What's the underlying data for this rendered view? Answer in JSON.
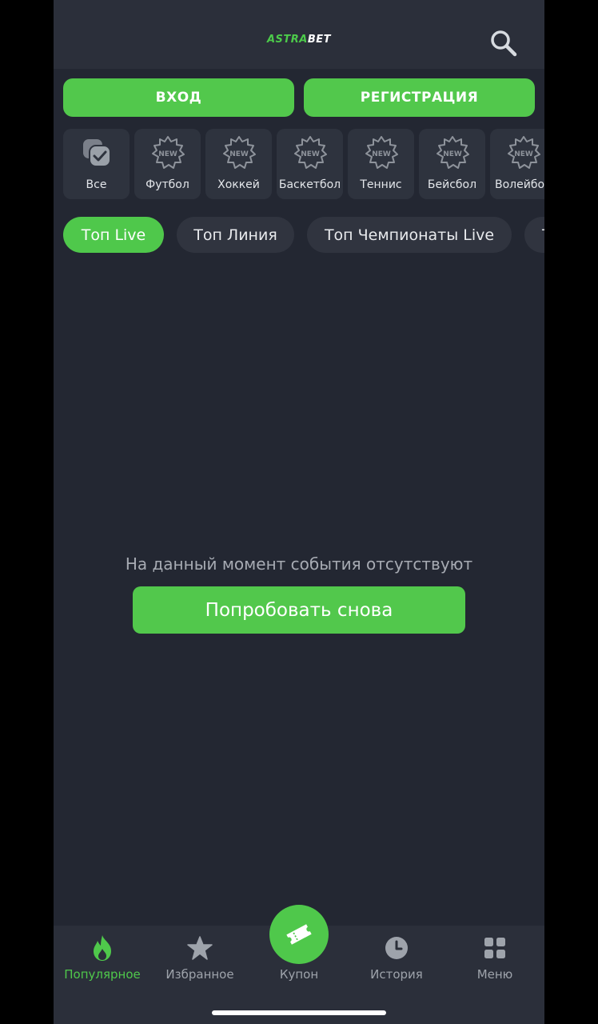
{
  "header": {
    "logo_part1": "ASTRA",
    "logo_part2": "BET",
    "search_icon": "search-icon"
  },
  "auth": {
    "login_label": "ВХОД",
    "register_label": "РЕГИСТРАЦИЯ"
  },
  "sports": [
    {
      "label": "Все",
      "icon": "all-sports-icon"
    },
    {
      "label": "Футбол",
      "icon": "new-badge-icon",
      "badge": "NEW"
    },
    {
      "label": "Хоккей",
      "icon": "new-badge-icon",
      "badge": "NEW"
    },
    {
      "label": "Баскетбол",
      "icon": "new-badge-icon",
      "badge": "NEW"
    },
    {
      "label": "Теннис",
      "icon": "new-badge-icon",
      "badge": "NEW"
    },
    {
      "label": "Бейсбол",
      "icon": "new-badge-icon",
      "badge": "NEW"
    },
    {
      "label": "Волейбол",
      "icon": "new-badge-icon",
      "badge": "NEW"
    }
  ],
  "tabs": [
    {
      "label": "Топ Live",
      "active": true
    },
    {
      "label": "Топ Линия",
      "active": false
    },
    {
      "label": "Топ Чемпионаты Live",
      "active": false
    },
    {
      "label": "Т",
      "active": false
    }
  ],
  "main": {
    "empty_message": "На данный момент события отсутствуют",
    "retry_label": "Попробовать снова"
  },
  "bottom_nav": [
    {
      "label": "Популярное",
      "icon": "flame-icon",
      "active": true
    },
    {
      "label": "Избранное",
      "icon": "star-icon",
      "active": false
    },
    {
      "label": "Купон",
      "icon": "ticket-icon",
      "active": false
    },
    {
      "label": "История",
      "icon": "clock-icon",
      "active": false
    },
    {
      "label": "Меню",
      "icon": "grid-icon",
      "active": false
    }
  ],
  "colors": {
    "accent": "#4fc84b",
    "background": "#232732",
    "panel": "#2b2f3a",
    "card": "#2e333e",
    "muted_text": "#a7abb3"
  }
}
